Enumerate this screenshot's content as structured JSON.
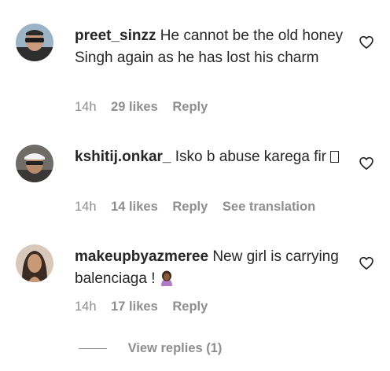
{
  "comments": [
    {
      "username": "preet_sinzz",
      "text": "He cannot be the old honey Singh again as he has lost his charm",
      "time": "14h",
      "likes": "29 likes",
      "reply": "Reply"
    },
    {
      "username": "kshitij.onkar_",
      "text": "Isko b abuse karega fir",
      "time": "14h",
      "likes": "14 likes",
      "reply": "Reply",
      "translate": "See translation"
    },
    {
      "username": "makeupbyazmeree",
      "text": "New girl is carrying balenciaga !",
      "time": "14h",
      "likes": "17 likes",
      "reply": "Reply"
    }
  ],
  "view_replies": "View replies (1)",
  "icons": {
    "heart": "heart-outline-icon",
    "emoji_missing": "missing-glyph-icon",
    "emoji_person": "person-tipping-hand-emoji"
  },
  "colors": {
    "text": "#262626",
    "secondary": "#8e8e8e"
  }
}
